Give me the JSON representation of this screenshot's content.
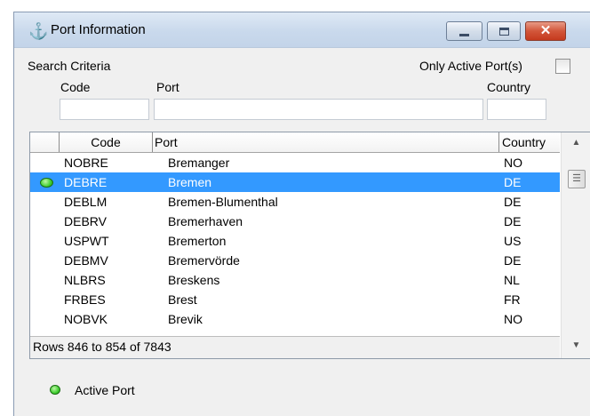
{
  "window": {
    "title": "Port Information",
    "icon": "anchor-icon"
  },
  "search": {
    "section_label": "Search Criteria",
    "only_active_label": "Only Active Port(s)",
    "only_active_checked": false,
    "code_label": "Code",
    "port_label": "Port",
    "country_label": "Country",
    "code_value": "",
    "port_value": "",
    "country_value": ""
  },
  "grid": {
    "columns": [
      "Code",
      "Port",
      "Country"
    ],
    "rows": [
      {
        "code": "NOBRE",
        "port": "Bremanger",
        "country": "NO",
        "active": false,
        "selected": false
      },
      {
        "code": "DEBRE",
        "port": "Bremen",
        "country": "DE",
        "active": true,
        "selected": true
      },
      {
        "code": "DEBLM",
        "port": "Bremen-Blumenthal",
        "country": "DE",
        "active": false,
        "selected": false
      },
      {
        "code": "DEBRV",
        "port": "Bremerhaven",
        "country": "DE",
        "active": false,
        "selected": false
      },
      {
        "code": "USPWT",
        "port": "Bremerton",
        "country": "US",
        "active": false,
        "selected": false
      },
      {
        "code": "DEBMV",
        "port": "Bremervörde",
        "country": "DE",
        "active": false,
        "selected": false
      },
      {
        "code": "NLBRS",
        "port": "Breskens",
        "country": "NL",
        "active": false,
        "selected": false
      },
      {
        "code": "FRBES",
        "port": "Brest",
        "country": "FR",
        "active": false,
        "selected": false
      },
      {
        "code": "NOBVK",
        "port": "Brevik",
        "country": "NO",
        "active": false,
        "selected": false
      }
    ],
    "footer": "Rows 846 to 854 of 7843"
  },
  "legend": {
    "active_label": "Active Port",
    "active_color": "#3fcf2f"
  },
  "colors": {
    "selection": "#3399ff",
    "close_button": "#d2563a"
  }
}
